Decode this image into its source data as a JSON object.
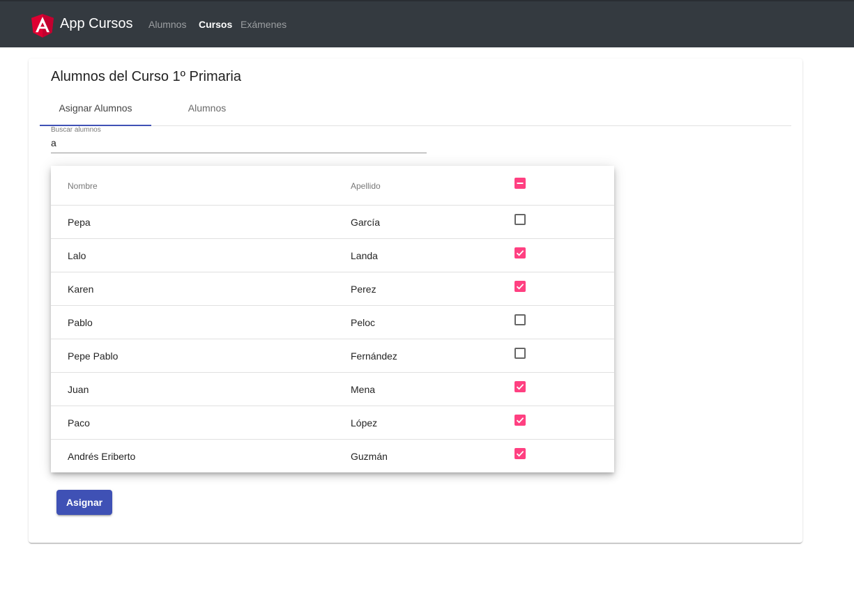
{
  "navbar": {
    "brand": "App Cursos",
    "links": [
      {
        "label": "Alumnos",
        "active": false
      },
      {
        "label": "Cursos",
        "active": true
      },
      {
        "label": "Exámenes",
        "active": false
      }
    ]
  },
  "card": {
    "title": "Alumnos del Curso 1º Primaria",
    "tabs": [
      {
        "label": "Asignar Alumnos",
        "active": true
      },
      {
        "label": "Alumnos",
        "active": false
      }
    ],
    "search": {
      "label": "Buscar alumnos",
      "value": "a"
    },
    "table": {
      "columns": [
        "Nombre",
        "Apellido"
      ],
      "select_all_state": "indeterminate",
      "rows": [
        {
          "nombre": "Pepa",
          "apellido": "García",
          "checked": false
        },
        {
          "nombre": "Lalo",
          "apellido": "Landa",
          "checked": true
        },
        {
          "nombre": "Karen",
          "apellido": "Perez",
          "checked": true
        },
        {
          "nombre": "Pablo",
          "apellido": "Peloc",
          "checked": false
        },
        {
          "nombre": "Pepe Pablo",
          "apellido": "Fernández",
          "checked": false
        },
        {
          "nombre": "Juan",
          "apellido": "Mena",
          "checked": true
        },
        {
          "nombre": "Paco",
          "apellido": "López",
          "checked": true
        },
        {
          "nombre": "Andrés Eriberto",
          "apellido": "Guzmán",
          "checked": true
        }
      ]
    },
    "assign_button": "Asignar"
  },
  "colors": {
    "navbar_bg": "#343a40",
    "primary": "#3f51b5",
    "accent": "#ff4081",
    "logo": "#dd0031"
  }
}
